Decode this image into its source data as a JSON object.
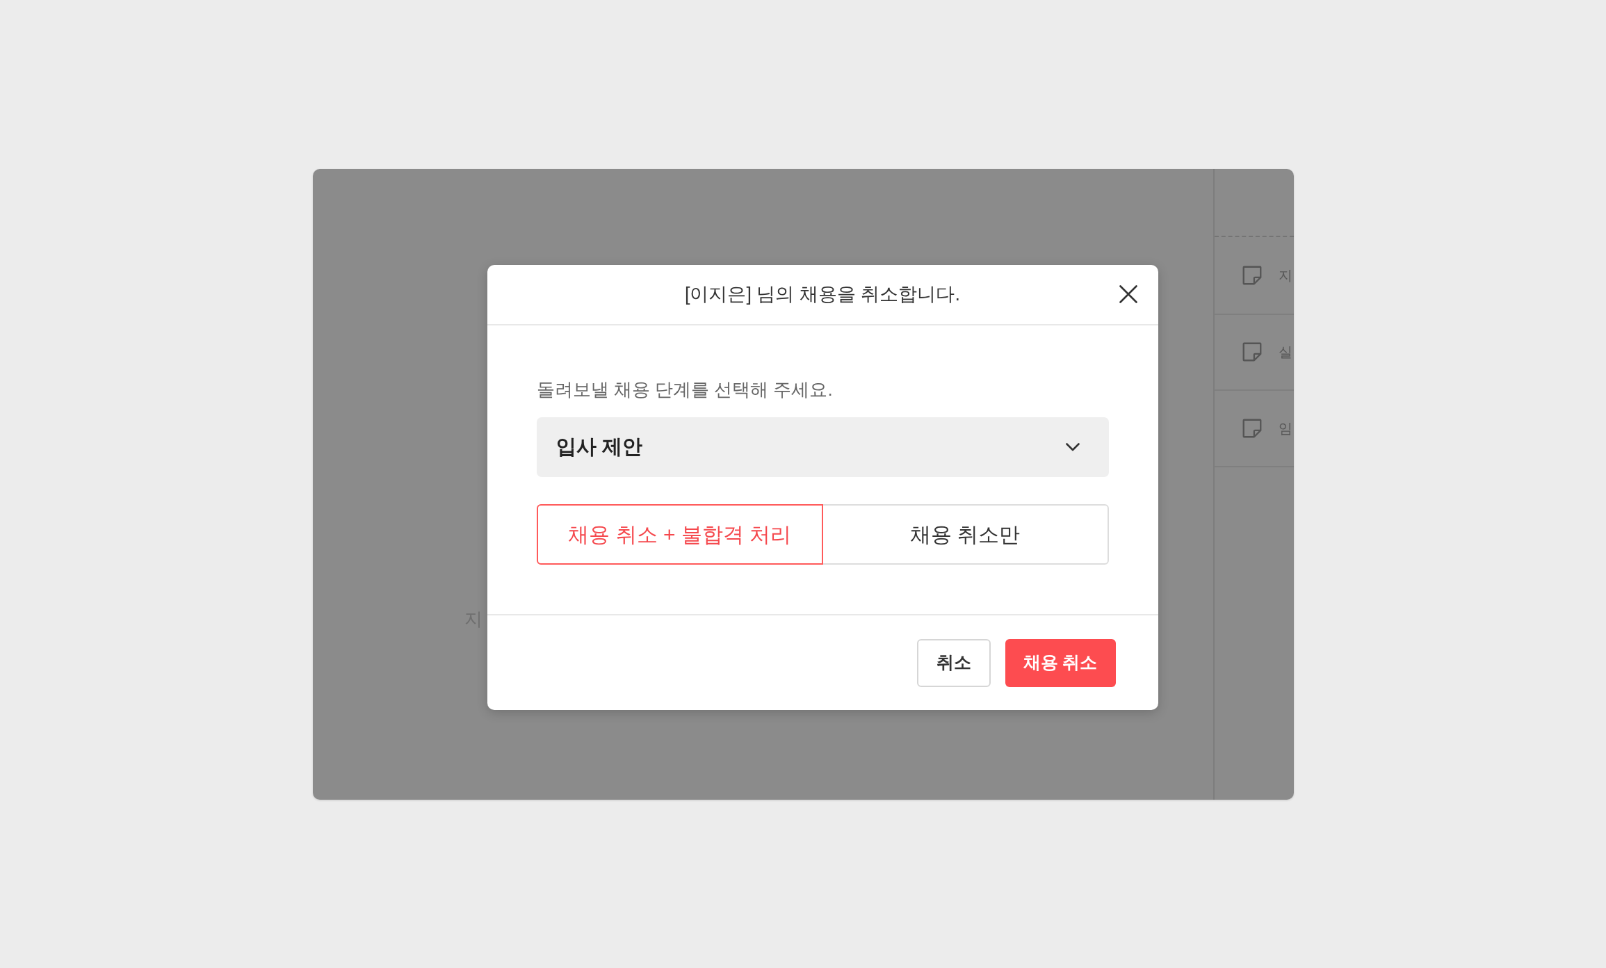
{
  "background_app": {
    "main_text": "지",
    "side_items": [
      {
        "label": "지"
      },
      {
        "label": "실"
      },
      {
        "label": "임"
      }
    ]
  },
  "dialog": {
    "title": "[이지은] 님의 채용을 취소합니다.",
    "prompt": "돌려보낼 채용 단계를 선택해 주세요.",
    "stage_select": {
      "value": "입사 제안"
    },
    "options": [
      {
        "label": "채용 취소 + 불합격 처리",
        "selected": true
      },
      {
        "label": "채용 취소만",
        "selected": false
      }
    ],
    "buttons": [
      {
        "label": "취소",
        "kind": "secondary"
      },
      {
        "label": "채용 취소",
        "kind": "primary"
      }
    ]
  }
}
